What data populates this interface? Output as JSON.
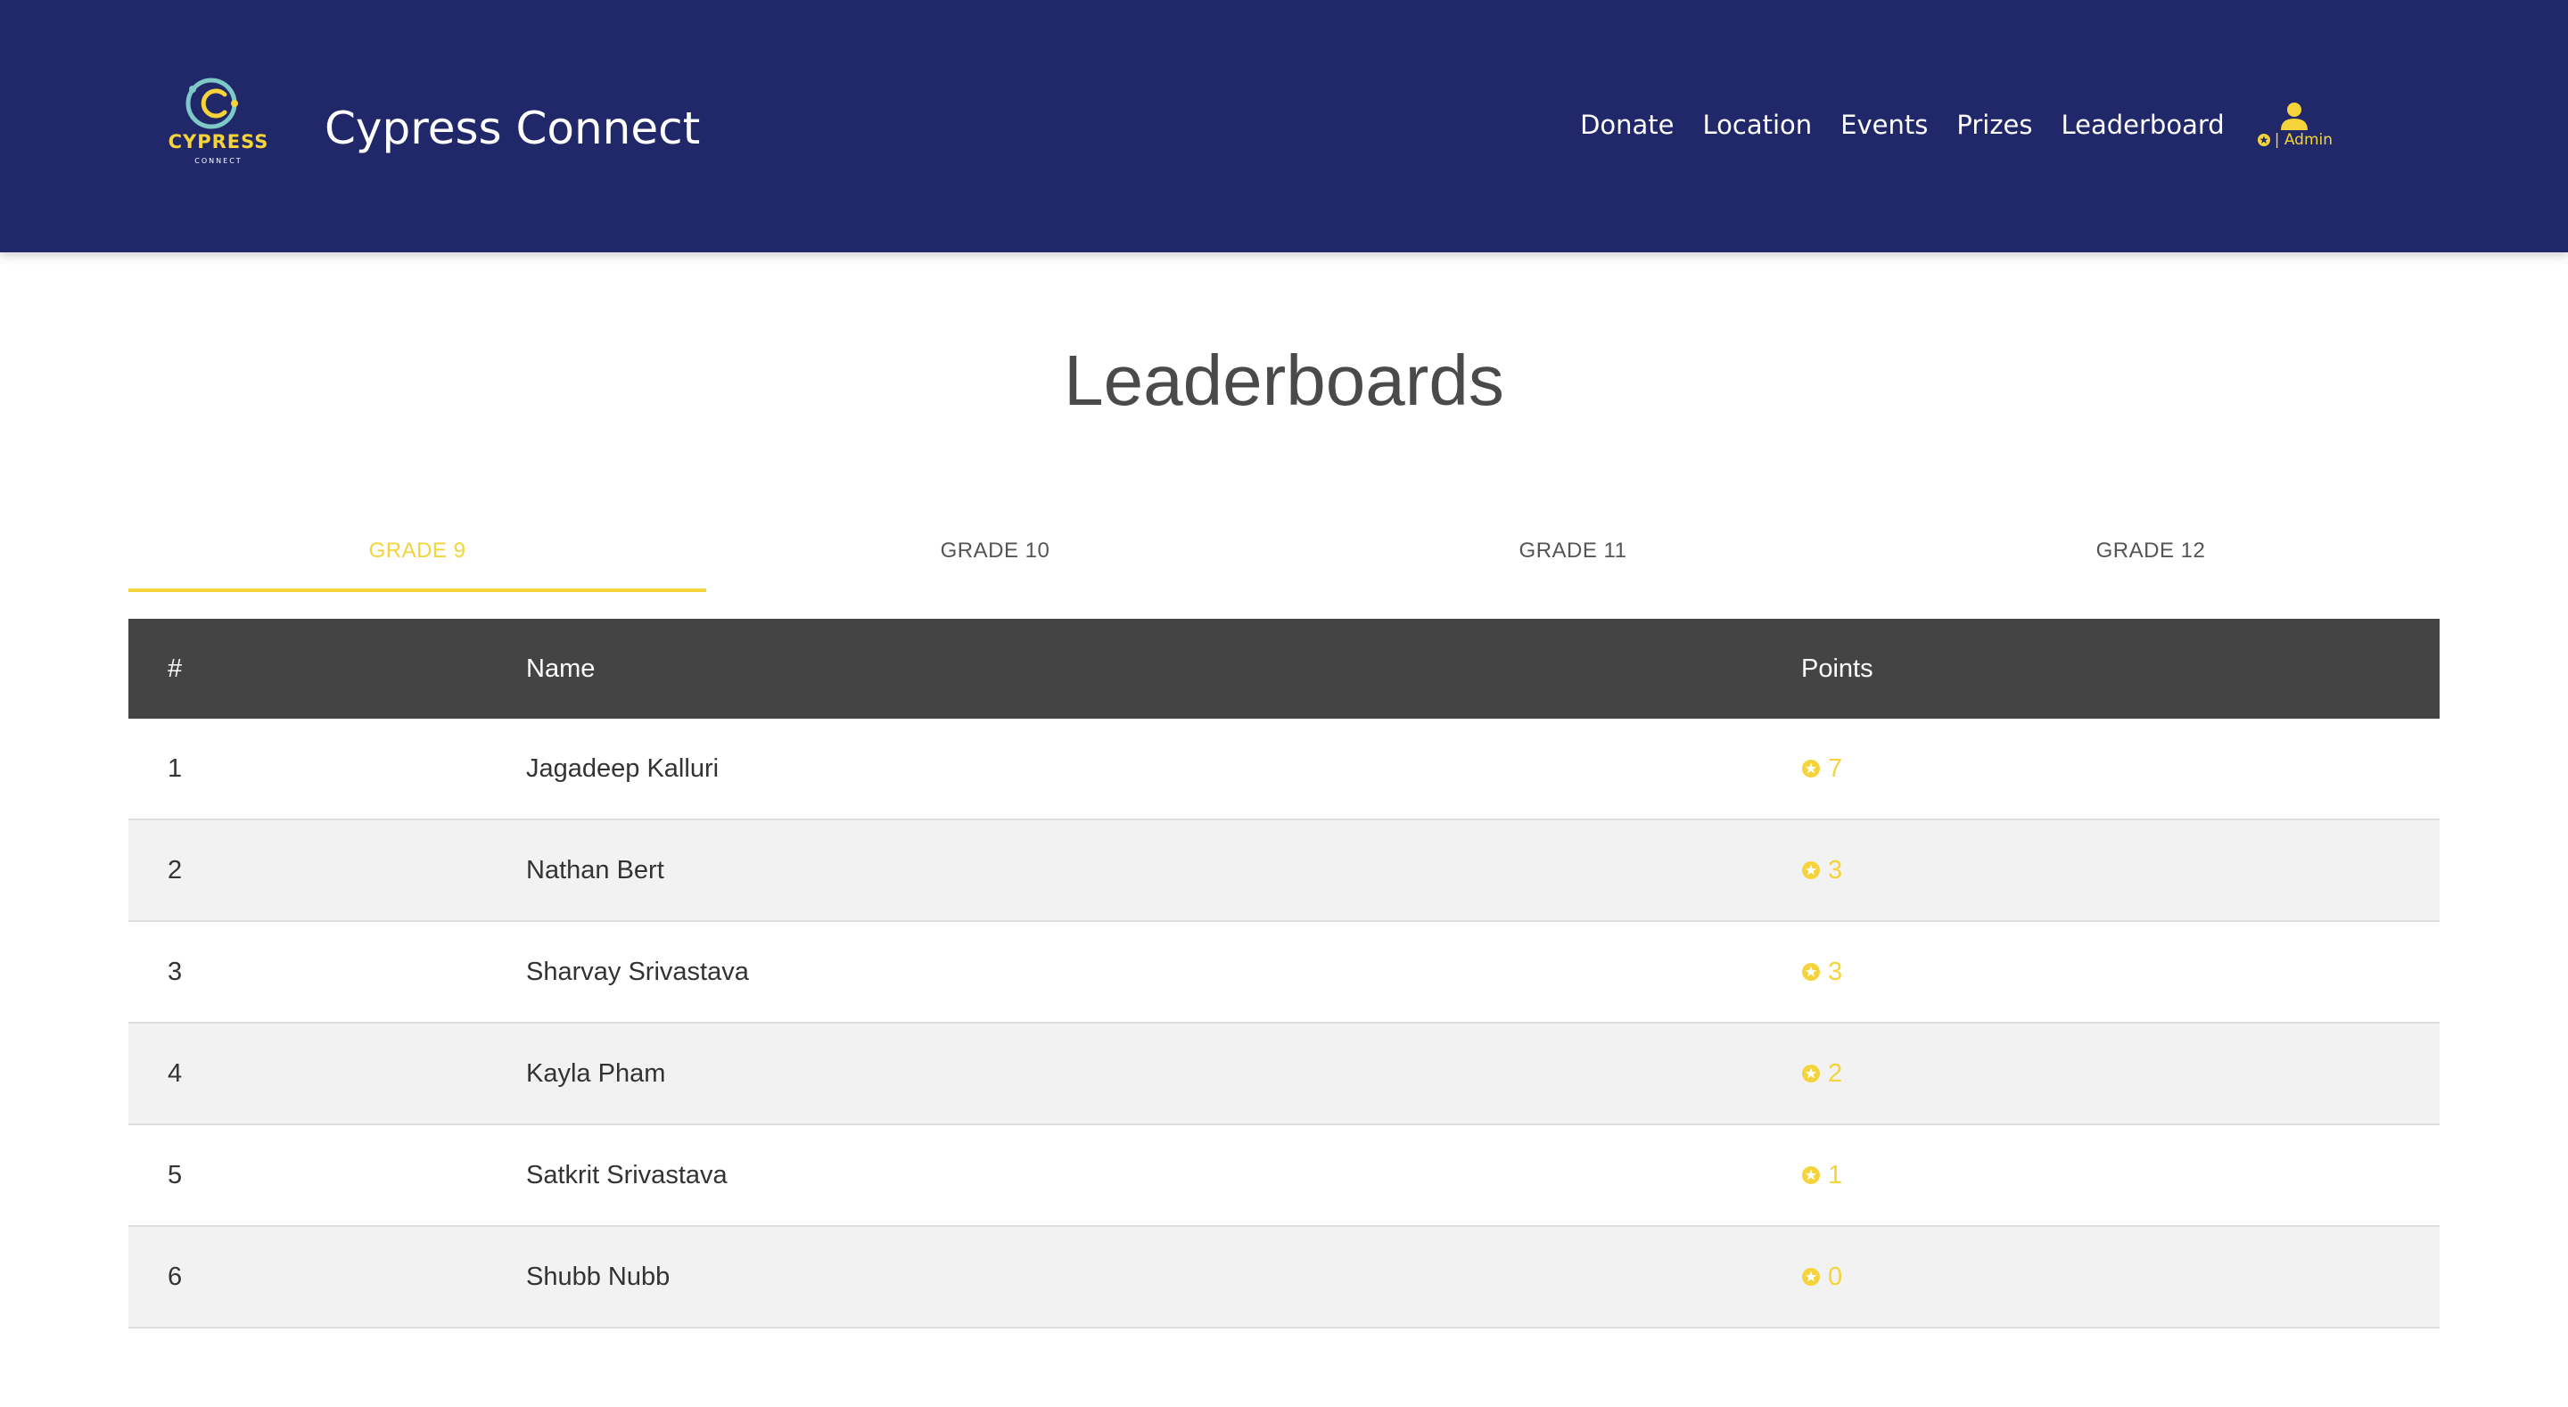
{
  "colors": {
    "header_bg": "#212869",
    "accent": "#f5d33a",
    "table_header_bg": "#444444"
  },
  "brand": {
    "logo_text": "CYPRESS",
    "logo_subtext": "CONNECT",
    "title": "Cypress Connect"
  },
  "nav": {
    "items": [
      {
        "label": "Donate"
      },
      {
        "label": "Location"
      },
      {
        "label": "Events"
      },
      {
        "label": "Prizes"
      },
      {
        "label": "Leaderboard"
      }
    ],
    "account": {
      "icon": "user-icon",
      "label": "| Admin"
    }
  },
  "page": {
    "title": "Leaderboards"
  },
  "tabs": [
    {
      "label": "GRADE 9",
      "active": true
    },
    {
      "label": "GRADE 10",
      "active": false
    },
    {
      "label": "GRADE 11",
      "active": false
    },
    {
      "label": "GRADE 12",
      "active": false
    }
  ],
  "table": {
    "headers": {
      "rank": "#",
      "name": "Name",
      "points": "Points"
    },
    "rows": [
      {
        "rank": "1",
        "name": "Jagadeep Kalluri",
        "points": "7"
      },
      {
        "rank": "2",
        "name": "Nathan Bert",
        "points": "3"
      },
      {
        "rank": "3",
        "name": "Sharvay Srivastava",
        "points": "3"
      },
      {
        "rank": "4",
        "name": "Kayla Pham",
        "points": "2"
      },
      {
        "rank": "5",
        "name": "Satkrit Srivastava",
        "points": "1"
      },
      {
        "rank": "6",
        "name": "Shubb Nubb",
        "points": "0"
      }
    ]
  }
}
